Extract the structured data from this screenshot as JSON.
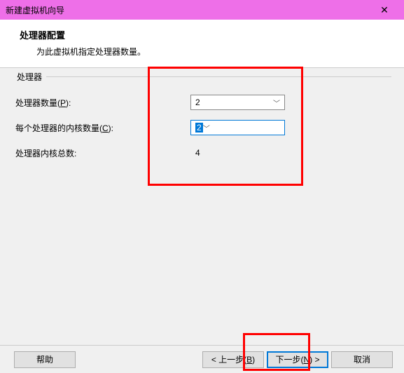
{
  "titlebar": {
    "title": "新建虚拟机向导",
    "close": "✕"
  },
  "header": {
    "heading": "处理器配置",
    "subheading": "为此虚拟机指定处理器数量。"
  },
  "group": {
    "label": "处理器"
  },
  "fields": {
    "processors": {
      "label_pre": "处理器数量(",
      "hotkey": "P",
      "label_post": "):",
      "value": "2"
    },
    "cores": {
      "label_pre": "每个处理器的内核数量(",
      "hotkey": "C",
      "label_post": "):",
      "value": "2"
    },
    "total": {
      "label": "处理器内核总数:",
      "value": "4"
    }
  },
  "footer": {
    "help": "帮助",
    "back_pre": "< 上一步(",
    "back_hotkey": "B",
    "back_post": ")",
    "next_pre": "下一步(",
    "next_hotkey": "N",
    "next_post": ") >",
    "cancel": "取消"
  }
}
